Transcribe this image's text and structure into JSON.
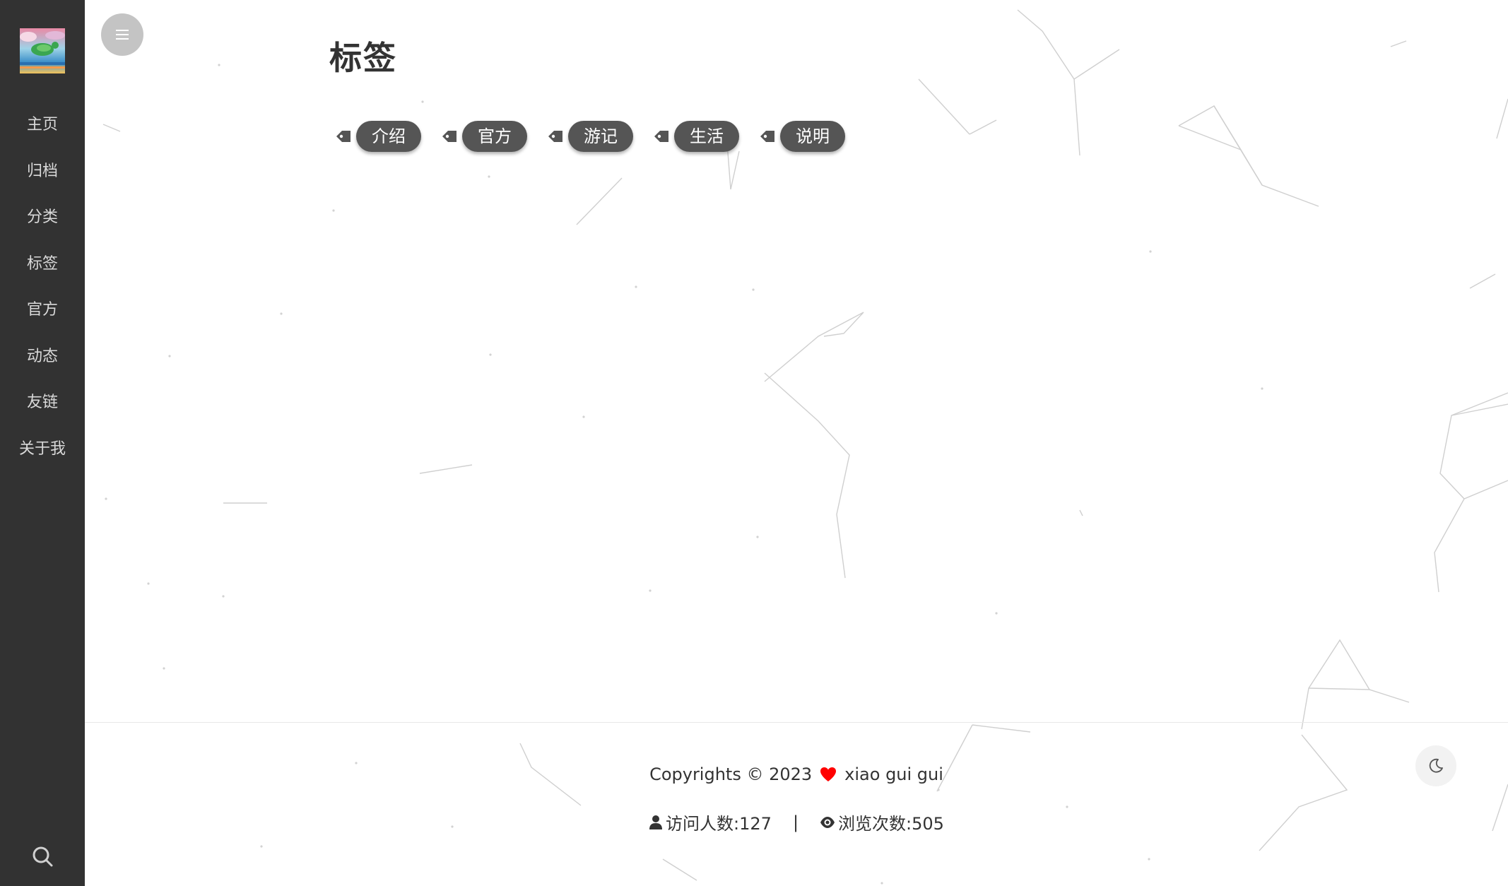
{
  "sidebar": {
    "items": [
      {
        "label": "主页"
      },
      {
        "label": "归档"
      },
      {
        "label": "分类"
      },
      {
        "label": "标签"
      },
      {
        "label": "官方"
      },
      {
        "label": "动态"
      },
      {
        "label": "友链"
      },
      {
        "label": "关于我"
      }
    ],
    "search_icon": "search-icon"
  },
  "header": {
    "menu_icon": "hamburger-icon"
  },
  "main": {
    "title": "标签",
    "tags": [
      {
        "label": "介绍"
      },
      {
        "label": "官方"
      },
      {
        "label": "游记"
      },
      {
        "label": "生活"
      },
      {
        "label": "说明"
      }
    ],
    "tag_icon": "tag-icon"
  },
  "footer": {
    "copyright": "Copyrights © 2023",
    "author": "xiao gui gui",
    "visitors": "访问人数:127",
    "separator": "|",
    "pageviews": "浏览次数:505",
    "heart_color": "#ff0000",
    "theme_icon": "moon-icon"
  },
  "colors": {
    "sidebar_bg": "#323232",
    "tag_bg": "#555555",
    "toggle_bg": "#c4c4c4"
  }
}
